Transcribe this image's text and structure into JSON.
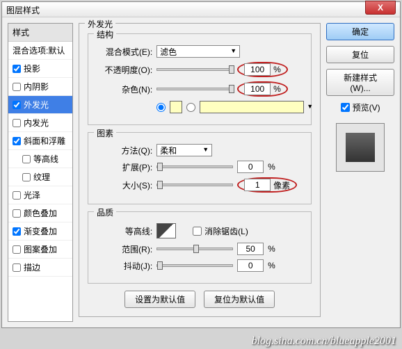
{
  "title": "图层样式",
  "sidebar": {
    "head": "样式",
    "sub": "混合选项:默认",
    "items": [
      {
        "label": "投影",
        "checked": true
      },
      {
        "label": "内阴影",
        "checked": false
      },
      {
        "label": "外发光",
        "checked": true,
        "selected": true
      },
      {
        "label": "内发光",
        "checked": false
      },
      {
        "label": "斜面和浮雕",
        "checked": true
      },
      {
        "label": "等高线",
        "checked": false,
        "indent": true
      },
      {
        "label": "纹理",
        "checked": false,
        "indent": true
      },
      {
        "label": "光泽",
        "checked": false
      },
      {
        "label": "颜色叠加",
        "checked": false
      },
      {
        "label": "渐变叠加",
        "checked": true
      },
      {
        "label": "图案叠加",
        "checked": false
      },
      {
        "label": "描边",
        "checked": false
      }
    ]
  },
  "panel": {
    "title": "外发光",
    "struct": {
      "legend": "结构",
      "blend_label": "混合模式(E):",
      "blend_value": "滤色",
      "opacity_label": "不透明度(O):",
      "opacity_value": "100",
      "opacity_unit": "%",
      "noise_label": "杂色(N):",
      "noise_value": "100",
      "noise_unit": "%"
    },
    "elem": {
      "legend": "图素",
      "method_label": "方法(Q):",
      "method_value": "柔和",
      "spread_label": "扩展(P):",
      "spread_value": "0",
      "spread_unit": "%",
      "size_label": "大小(S):",
      "size_value": "1",
      "size_unit": "像素"
    },
    "qual": {
      "legend": "品质",
      "contour_label": "等高线:",
      "aa_label": "消除锯齿(L)",
      "range_label": "范围(R):",
      "range_value": "50",
      "range_unit": "%",
      "jitter_label": "抖动(J):",
      "jitter_value": "0",
      "jitter_unit": "%"
    },
    "btn_default": "设置为默认值",
    "btn_reset": "复位为默认值"
  },
  "right": {
    "ok": "确定",
    "reset": "复位",
    "newstyle": "新建样式(W)...",
    "preview": "预览(V)"
  },
  "watermark": "blog.sina.com.cn/blueapple2001"
}
